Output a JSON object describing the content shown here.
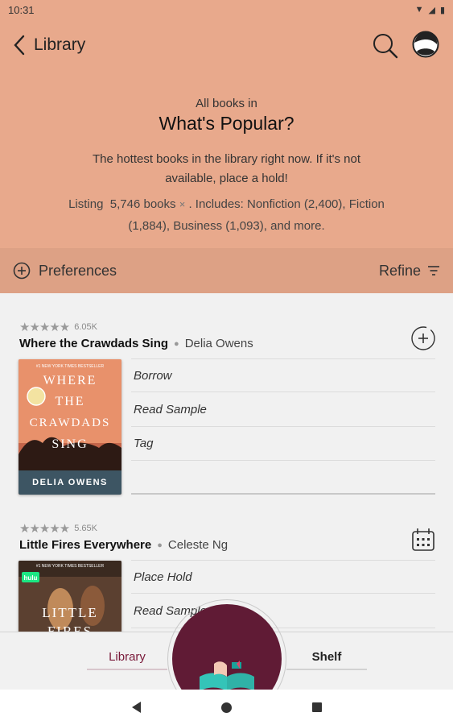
{
  "status_bar": {
    "time": "10:31"
  },
  "header": {
    "back_label": "Library",
    "subtitle": "All books in",
    "title": "What's Popular?",
    "description": "The hottest books in the library right now. If it's not available, place a hold!",
    "listing_prefix": "Listing",
    "listing_count": "5,746 books",
    "listing_close": "×",
    "listing_suffix": ". Includes: Nonfiction (2,400), Fiction (1,884), Business (1,093), and more."
  },
  "preferences_bar": {
    "preferences_label": "Preferences",
    "refine_label": "Refine"
  },
  "books": [
    {
      "rating_count": "6.05K",
      "title": "Where the Crawdads Sing",
      "author": "Delia Owens",
      "action_icon": "add-circle-icon",
      "cover": {
        "banner": "#1 NEW YORK TIMES BESTSELLER",
        "title_lines": [
          "WHERE",
          "THE",
          "CRAWDADS",
          "SING"
        ],
        "author": "DELIA OWENS",
        "bg": "#e8916b"
      },
      "actions": [
        "Borrow",
        "Read Sample",
        "Tag"
      ]
    },
    {
      "rating_count": "5.65K",
      "title": "Little Fires Everywhere",
      "author": "Celeste Ng",
      "action_icon": "calendar-icon",
      "cover": {
        "banner": "#1 NEW YORK TIMES BESTSELLER",
        "title_lines": [
          "LITTLE",
          "FIRES"
        ],
        "badge": "hulu",
        "bg": "#3a2a20"
      },
      "actions": [
        "Place Hold",
        "Read Sample"
      ]
    }
  ],
  "bottom_nav": {
    "library_label": "Library",
    "shelf_label": "Shelf"
  },
  "colors": {
    "header_bg": "#e8a98c",
    "pref_bg": "#dda185",
    "fab": "#601b35",
    "accent": "#7a1a3a"
  }
}
